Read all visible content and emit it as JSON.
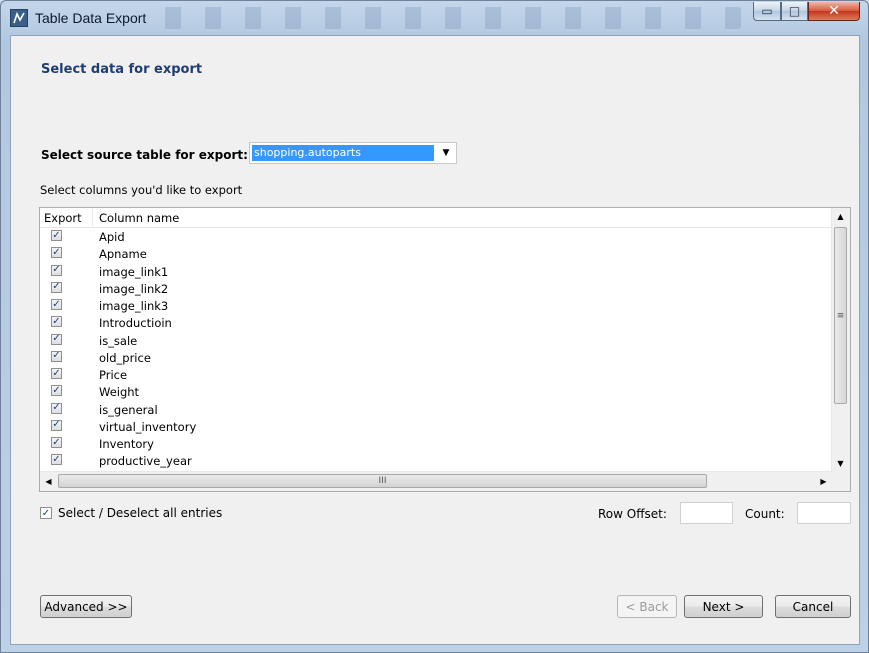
{
  "window": {
    "title": "Table Data Export",
    "controls": {
      "minimize": "▭",
      "maximize": "□",
      "close": "✕"
    }
  },
  "page": {
    "heading": "Select data for export",
    "source_label": "Select source table for export:",
    "source_value": "shopping.autoparts",
    "columns_label": "Select columns you'd like to export"
  },
  "table": {
    "headers": {
      "export": "Export",
      "name": "Column name"
    },
    "rows": [
      {
        "name": "Apid",
        "checked": true
      },
      {
        "name": "Apname",
        "checked": true
      },
      {
        "name": "image_link1",
        "checked": true
      },
      {
        "name": "image_link2",
        "checked": true
      },
      {
        "name": "image_link3",
        "checked": true
      },
      {
        "name": "Introductioin",
        "checked": true
      },
      {
        "name": "is_sale",
        "checked": true
      },
      {
        "name": "old_price",
        "checked": true
      },
      {
        "name": "Price",
        "checked": true
      },
      {
        "name": "Weight",
        "checked": true
      },
      {
        "name": "is_general",
        "checked": true
      },
      {
        "name": "virtual_inventory",
        "checked": true
      },
      {
        "name": "Inventory",
        "checked": true
      },
      {
        "name": "productive_year",
        "checked": true
      }
    ],
    "scroll_grip": "≡",
    "hscroll_grip": "III"
  },
  "options": {
    "select_all_label": "Select / Deselect all entries",
    "select_all_checked": true,
    "row_offset_label": "Row Offset:",
    "row_offset_value": "",
    "count_label": "Count:",
    "count_value": ""
  },
  "buttons": {
    "advanced": "Advanced >>",
    "back": "< Back",
    "next": "Next >",
    "cancel": "Cancel"
  },
  "icons": {
    "checkmark": "✓",
    "arrow_down": "▼",
    "arrow_up": "▲",
    "arrow_left": "◀",
    "arrow_right": "▶"
  }
}
